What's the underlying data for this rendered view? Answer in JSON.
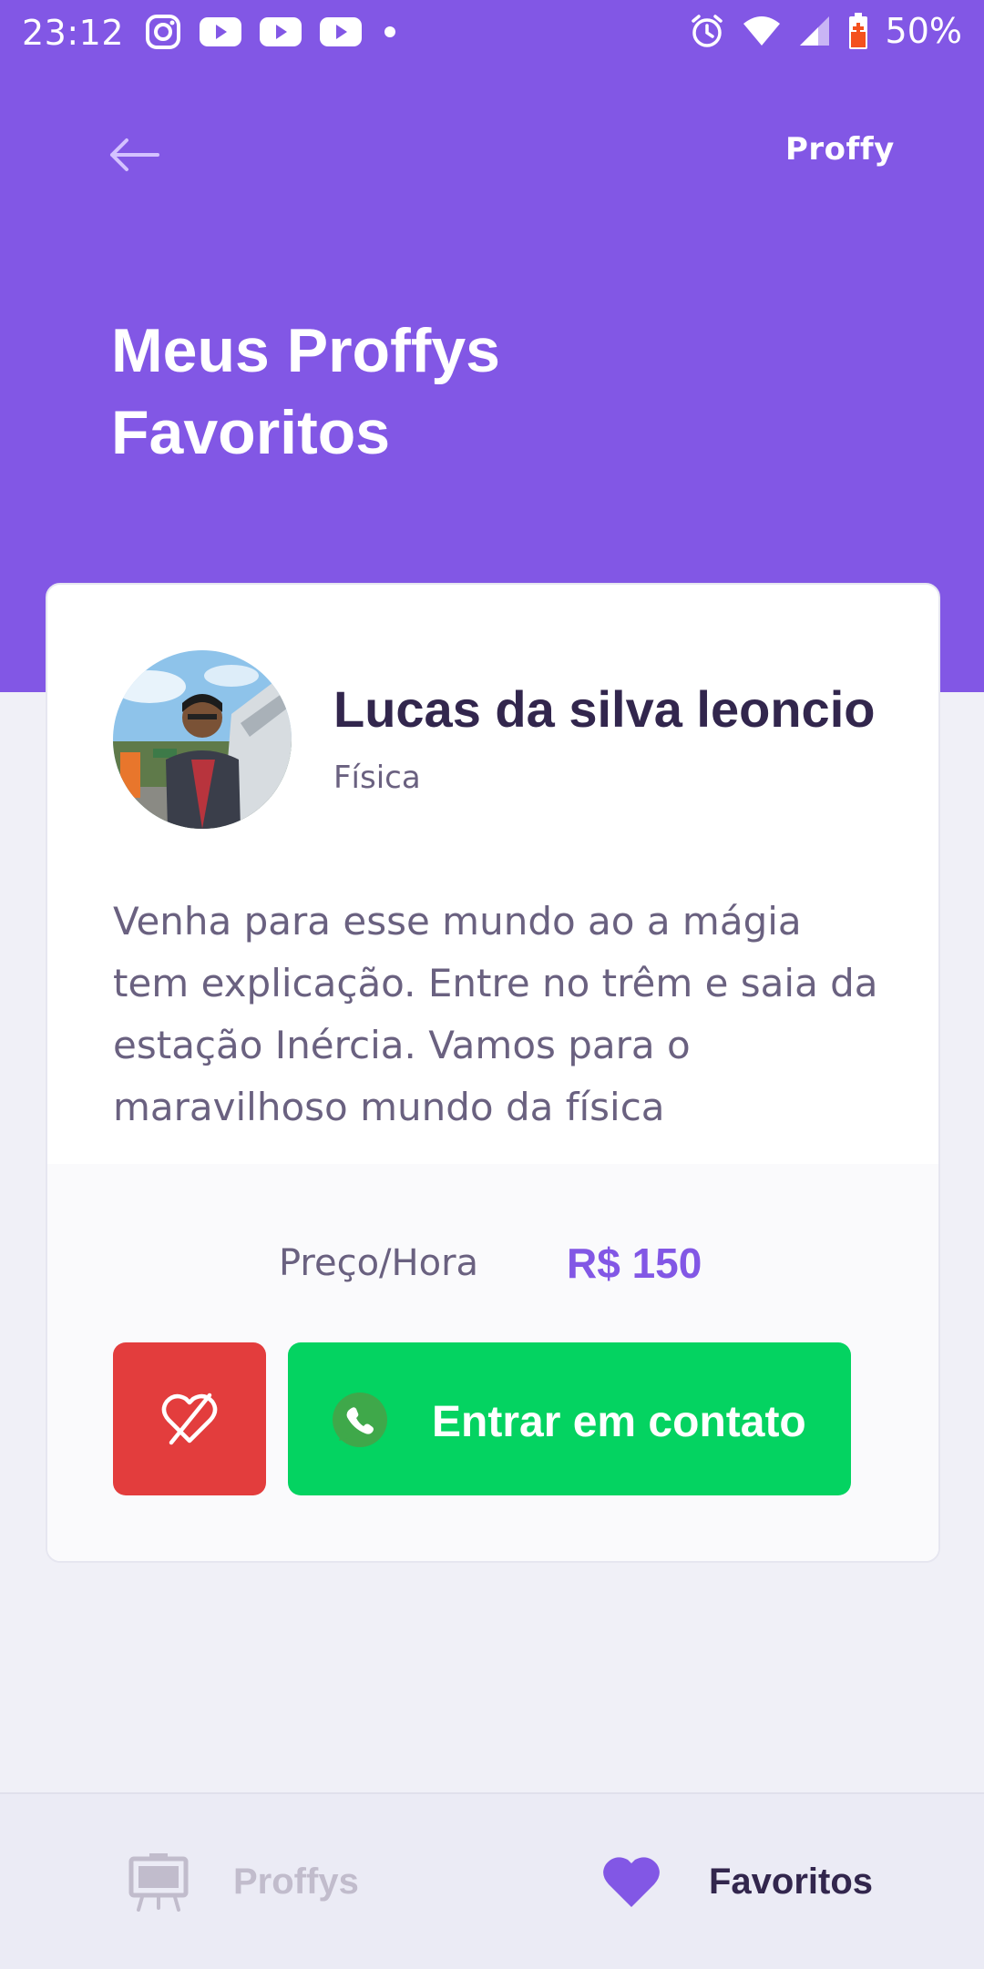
{
  "status_bar": {
    "time": "23:12",
    "battery": "50%",
    "notification_icons": [
      "instagram-icon",
      "youtube-icon",
      "youtube-icon",
      "youtube-icon",
      "dot-icon"
    ],
    "system_icons": [
      "alarm-icon",
      "wifi-icon",
      "signal-icon",
      "battery-icon"
    ]
  },
  "header": {
    "brand": "Proffy",
    "title_line1": "Meus Proffys",
    "title_line2": "Favoritos",
    "background_color": "#8257E5"
  },
  "teacher_card": {
    "name": "Lucas da silva leoncio",
    "subject": "Física",
    "bio": "Venha para esse mundo ao a mágia tem explicação. Entre no trêm e saia da estação Inércia. Vamos para o maravilhoso mundo da física",
    "price_label": "Preço/Hora",
    "price_value": "R$ 150",
    "contact_label": "Entrar em contato",
    "unfavorite_icon": "heart-off-icon",
    "contact_icon": "whatsapp-icon"
  },
  "tab_bar": {
    "tabs": [
      {
        "label": "Proffys",
        "icon": "easel-icon",
        "active": false
      },
      {
        "label": "Favoritos",
        "icon": "heart-icon",
        "active": true
      }
    ]
  },
  "colors": {
    "primary": "#8257E5",
    "success": "#04D361",
    "danger": "#E33D3D",
    "title_text": "#32264D",
    "body_text": "#6A6180"
  }
}
